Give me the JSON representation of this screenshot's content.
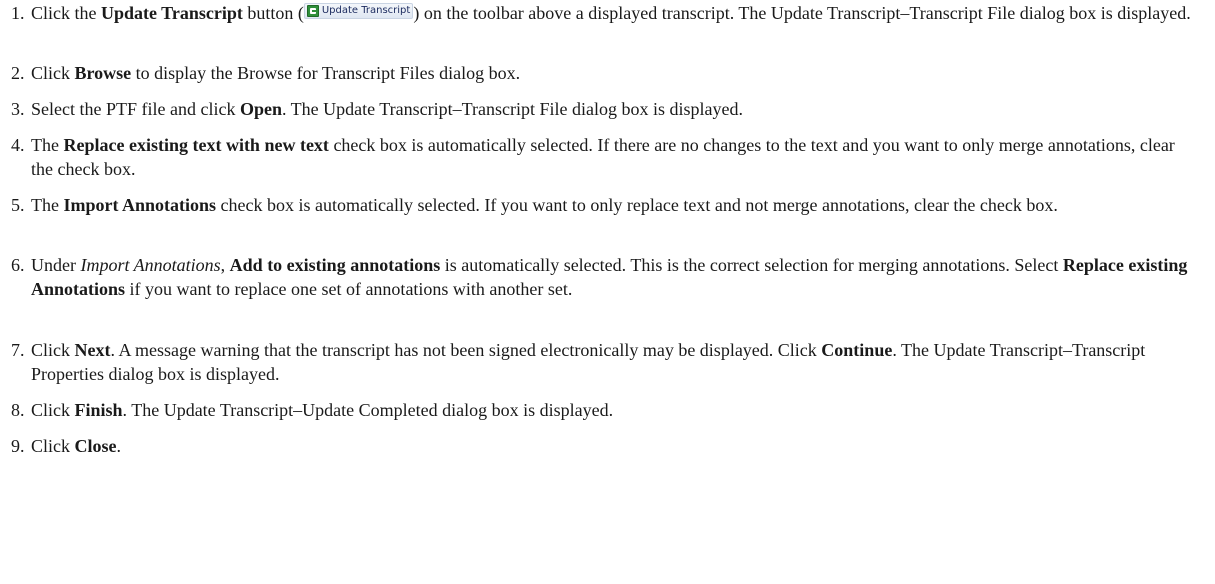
{
  "steps": [
    {
      "num": "1.",
      "parts": [
        "Click the ",
        "Update Transcript",
        " button (",
        ") on the toolbar above a displayed transcript. The Update Transcript–Transcript File dialog box is displayed."
      ],
      "inline_button": {
        "label": "Update Transcript",
        "icon": "update-transcript-icon"
      }
    },
    {
      "num": "2.",
      "parts": [
        "Click ",
        "Browse",
        " to display the Browse for Transcript Files dialog box."
      ]
    },
    {
      "num": "3.",
      "parts": [
        "Select the PTF file and click ",
        "Open",
        ". The Update Transcript–Transcript File dialog box is displayed."
      ]
    },
    {
      "num": "4.",
      "parts": [
        "The ",
        "Replace existing text with new text",
        " check box is automatically selected. If there are no changes to the text and you want to only merge annotations, clear the check box."
      ]
    },
    {
      "num": "5.",
      "parts": [
        "The ",
        "Import Annotations",
        " check box is automatically selected. If you want to only replace text and not merge annotations, clear the check box."
      ]
    },
    {
      "num": "6.",
      "parts": [
        "Under ",
        "Import Annotations",
        ", ",
        "Add to existing annotations",
        " is automatically selected. This is the correct selection for merging annotations. Select ",
        "Replace existing Annotations",
        " if you want to replace one set of annotations with another set."
      ]
    },
    {
      "num": "7.",
      "parts": [
        "Click ",
        "Next",
        ". A message warning that the transcript has not been signed electronically may be displayed. Click ",
        "Continue",
        ". The Update Transcript–Transcript Properties dialog box is displayed."
      ]
    },
    {
      "num": "8.",
      "parts": [
        "Click ",
        "Finish",
        ". The Update Transcript–Update Completed dialog box is displayed."
      ]
    },
    {
      "num": "9.",
      "parts": [
        "Click ",
        "Close",
        "."
      ]
    }
  ]
}
